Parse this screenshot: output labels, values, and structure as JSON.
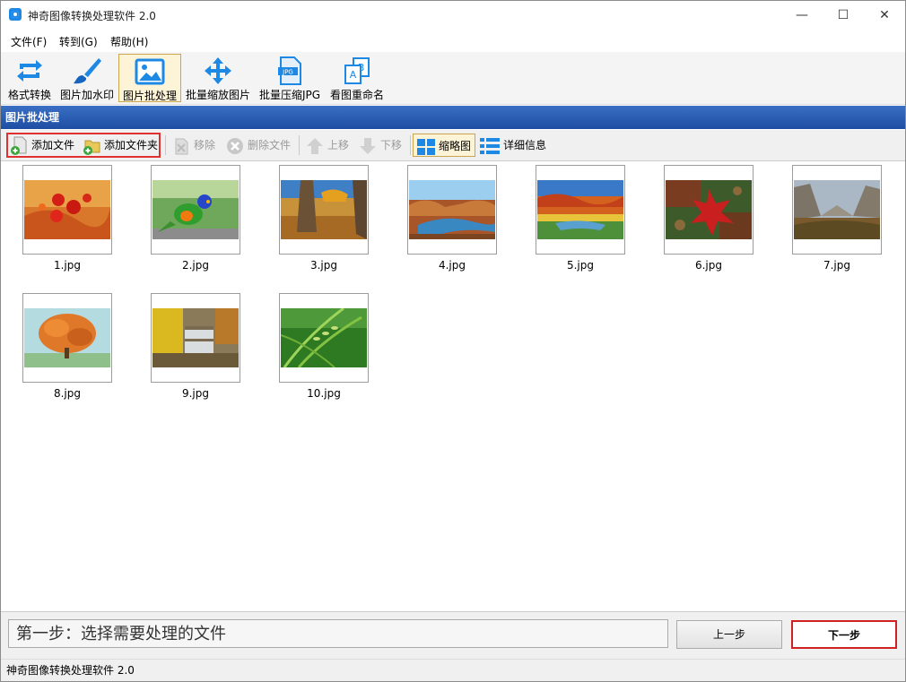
{
  "window": {
    "title": "神奇图像转换处理软件 2.0",
    "minimize": "—",
    "maximize": "☐",
    "close": "✕"
  },
  "menu": [
    "文件(F)",
    "转到(G)",
    "帮助(H)"
  ],
  "toolbar": [
    {
      "label": "格式转换",
      "icon": "convert-arrows-icon"
    },
    {
      "label": "图片加水印",
      "icon": "paint-brush-icon"
    },
    {
      "label": "图片批处理",
      "icon": "image-icon",
      "active": true
    },
    {
      "label": "批量缩放图片",
      "icon": "move-arrows-icon"
    },
    {
      "label": "批量压缩JPG",
      "icon": "jpg-file-icon"
    },
    {
      "label": "看图重命名",
      "icon": "rename-icon"
    }
  ],
  "section_title": "图片批处理",
  "subtoolbar": {
    "add_file": "添加文件",
    "add_folder": "添加文件夹",
    "remove": "移除",
    "delete_file": "删除文件",
    "move_up": "上移",
    "move_down": "下移",
    "thumbnails": "缩略图",
    "details": "详细信息"
  },
  "files": [
    {
      "name": "1.jpg",
      "theme": "rose hips"
    },
    {
      "name": "2.jpg",
      "theme": "parrot"
    },
    {
      "name": "3.jpg",
      "theme": "autumn tree"
    },
    {
      "name": "4.jpg",
      "theme": "river"
    },
    {
      "name": "5.jpg",
      "theme": "autumn lake"
    },
    {
      "name": "6.jpg",
      "theme": "red leaf"
    },
    {
      "name": "7.jpg",
      "theme": "valley"
    },
    {
      "name": "8.jpg",
      "theme": "orange tree"
    },
    {
      "name": "9.jpg",
      "theme": "waterfall"
    },
    {
      "name": "10.jpg",
      "theme": "rice plant"
    }
  ],
  "footer": {
    "step_text": "第一步：选择需要处理的文件",
    "prev": "上一步",
    "next": "下一步"
  },
  "status": "神奇图像转换处理软件 2.0"
}
